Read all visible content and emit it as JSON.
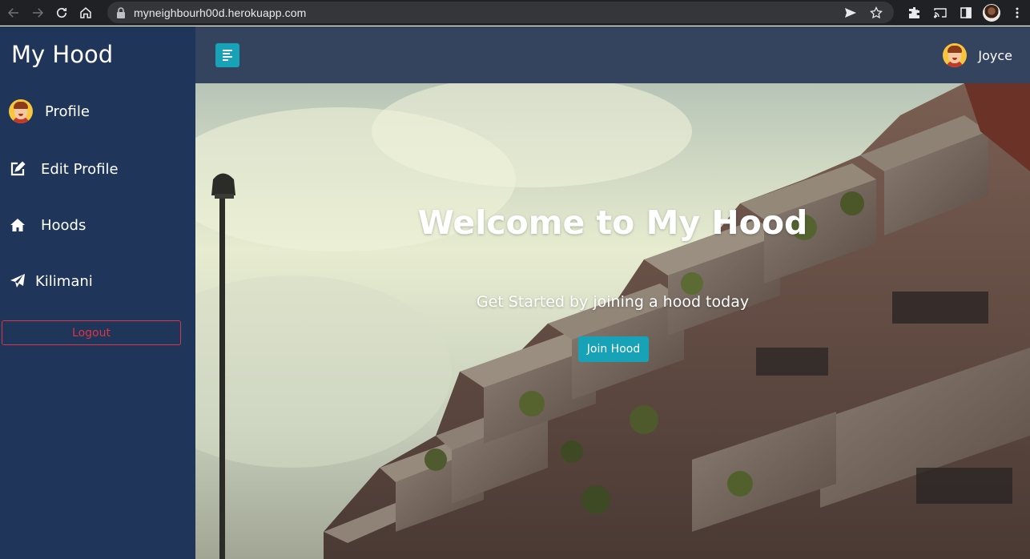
{
  "browser": {
    "url": "myneighbourh00d.herokuapp.com",
    "icons": [
      "back-icon",
      "forward-icon",
      "reload-icon",
      "home-icon",
      "lock-icon",
      "send-icon",
      "star-icon",
      "extensions-icon",
      "cast-icon",
      "sidepanel-icon",
      "profile-avatar",
      "menu-icon"
    ]
  },
  "sidebar": {
    "brand": "My Hood",
    "items": [
      {
        "label": "Profile",
        "icon": "avatar-icon"
      },
      {
        "label": "Edit Profile",
        "icon": "edit-icon"
      },
      {
        "label": "Hoods",
        "icon": "home-icon"
      },
      {
        "label": "Kilimani",
        "icon": "paper-plane-icon"
      }
    ],
    "logout_label": "Logout"
  },
  "topbar": {
    "toggle_icon": "sidebar-toggle-icon",
    "username": "Joyce"
  },
  "hero": {
    "title": "Welcome to My Hood",
    "subtitle": "Get Started by joining a hood today",
    "cta_label": "Join Hood"
  },
  "colors": {
    "sidebar_bg": "#1f355a",
    "topbar_bg": "#34435e",
    "accent": "#17a2b8",
    "danger": "#dc3545"
  }
}
